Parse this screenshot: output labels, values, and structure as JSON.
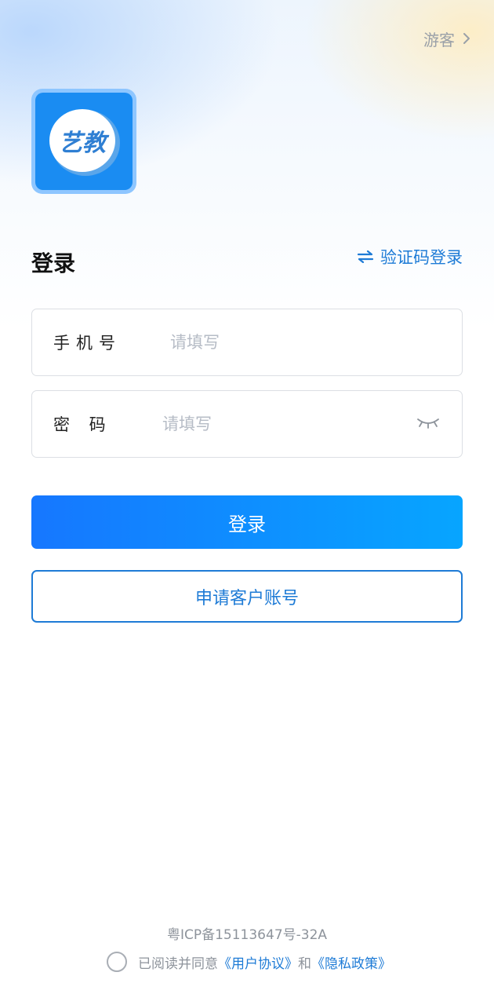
{
  "header": {
    "guest_label": "游客"
  },
  "logo": {
    "text": "艺教"
  },
  "login": {
    "title": "登录",
    "switch_label": "验证码登录",
    "phone_label": "手机号",
    "phone_placeholder": "请填写",
    "password_label": "密 码",
    "password_placeholder": "请填写",
    "submit_label": "登录",
    "apply_label": "申请客户账号"
  },
  "footer": {
    "icp": "粤ICP备15113647号-32A",
    "agree_prefix": "已阅读并同意",
    "user_agreement": "《用户协议》",
    "and": "和",
    "privacy_policy": "《隐私政策》"
  },
  "colors": {
    "accent": "#1e7bd6",
    "button_start": "#1677ff",
    "button_end": "#07a5ff",
    "logo_bg": "#1a8cf2"
  },
  "icons": [
    "chevron-right-icon",
    "swap-icon",
    "eye-closed-icon",
    "app-logo"
  ]
}
